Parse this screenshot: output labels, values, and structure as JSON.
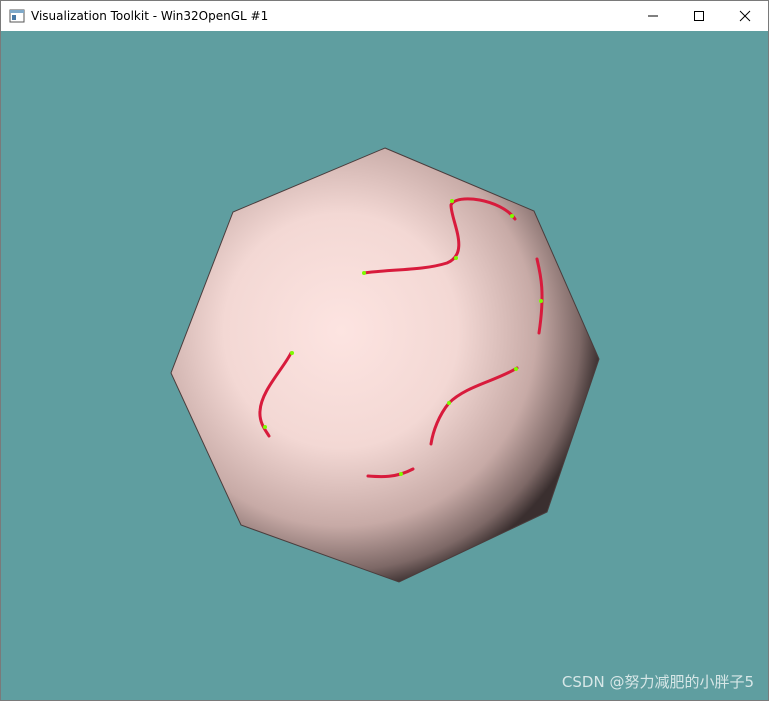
{
  "window": {
    "title": "Visualization Toolkit - Win32OpenGL #1",
    "app_icon": "vtk-window-icon",
    "controls": [
      "minimize-icon",
      "maximize-icon",
      "close-icon"
    ]
  },
  "viewport": {
    "background_color": "#5f9ea0",
    "object": "shaded-sphere-with-streamlines",
    "streamline_color": "#d81b3c",
    "seed_point_color": "#7cfc00",
    "sphere_color": "#fde4e1"
  },
  "watermark": {
    "text": "CSDN @努力减肥的小胖子5"
  }
}
